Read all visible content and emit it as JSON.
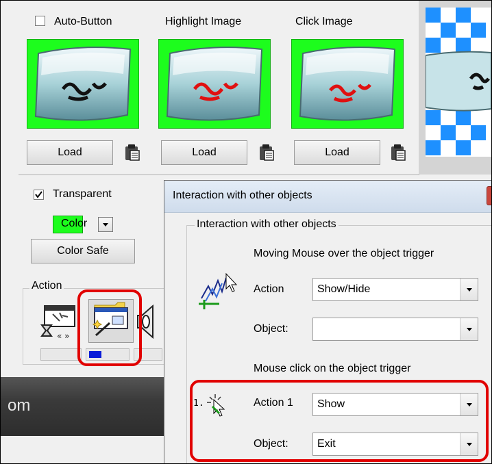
{
  "images_panel": {
    "auto_button_label": "Auto-Button",
    "highlight_label": "Highlight Image",
    "click_label": "Click Image",
    "load_label": "Load",
    "thumb_background": "#1dfd1d"
  },
  "appearance": {
    "transparent_label": "Transparent",
    "transparent_checked": true,
    "color_label": "Color",
    "color_safe_label": "Color Safe"
  },
  "action_group": {
    "label": "Action",
    "icons": [
      "hourglass-window-icon",
      "window-wand-icon",
      "speaker-icon"
    ]
  },
  "background_strip": {
    "text": "om"
  },
  "dialog": {
    "title": "Interaction with other objects",
    "group_label": "Interaction with other objects",
    "hover_section": {
      "heading": "Moving Mouse over the object trigger",
      "action_label": "Action",
      "action_value": "Show/Hide",
      "object_label": "Object:",
      "object_value": ""
    },
    "click_section": {
      "heading": "Mouse click on the object trigger",
      "step_number": "1.",
      "action_label": "Action 1",
      "action_value": "Show",
      "object_label": "Object:",
      "object_value": "Exit"
    }
  },
  "colors": {
    "highlight_ring": "#e10000",
    "thumb_green": "#1dfd1d",
    "checker_blue": "#1e90ff"
  }
}
